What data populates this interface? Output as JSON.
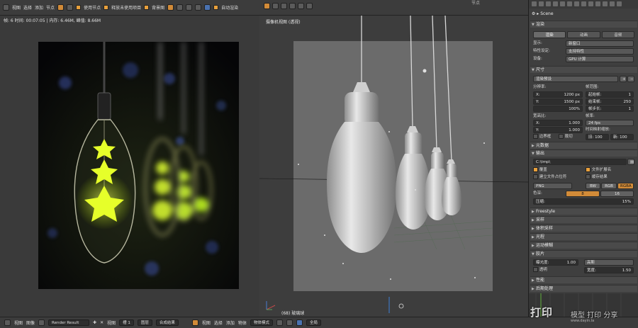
{
  "top_menu": {
    "view": "视图",
    "select": "选择",
    "add": "添加",
    "node": "节点",
    "use_nodes": "使用节点",
    "free_unused": "释放未使用项目",
    "backdrop": "背景图",
    "auto_render": "自动渲染",
    "node_panel_label": "节点"
  },
  "image_editor": {
    "stats": "帧: 6 时间: 00:07:05 | 内存: 6.46M, 峰值: 8.66M"
  },
  "viewport": {
    "title": "摄像机视图 (透视)",
    "object_label": "(68) 玻璃球",
    "mode": "物体模式",
    "menu": [
      "视图",
      "选择",
      "添加",
      "物体"
    ],
    "global": "全局"
  },
  "properties": {
    "scene": "Scene",
    "render_panel": "渲染",
    "render_tabs": [
      "渲染",
      "动画",
      "音频"
    ],
    "display_label": "显示:",
    "display_value": "新窗口",
    "feature_set_label": "特性设定:",
    "feature_set_value": "支持特性",
    "device_label": "设备:",
    "device_value": "GPU 计算",
    "dimensions_panel": "尺寸",
    "preset_value": "渲染预设",
    "resolution_label": "分辨率:",
    "res_x": "X:",
    "res_x_value": "1200 px",
    "res_y": "Y:",
    "res_y_value": "1500 px",
    "res_percent": "100%",
    "frame_range_label": "帧范围:",
    "start_label": "起始帧:",
    "start_value": "1",
    "end_label": "结束帧:",
    "end_value": "250",
    "step_label": "帧步长:",
    "step_value": "1",
    "aspect_label": "宽高比:",
    "aspect_x": "X:",
    "aspect_x_value": "1.000",
    "aspect_y": "Y:",
    "aspect_y_value": "1.000",
    "border_label": "边界框",
    "crop_label": "裁切",
    "frame_rate_label": "帧率:",
    "frame_rate_value": "24 fps",
    "time_remap_label": "时间映射缩放:",
    "remap_old": "旧: 100",
    "remap_new": "新: 100",
    "metadata_panel": "元数据",
    "output_panel": "输出",
    "output_path": "C:\\tmp\\",
    "overwrite_label": "覆盖",
    "file_ext_label": "文件扩展名",
    "placeholders_label": "建立文件占位符",
    "cache_result_label": "缓存结果",
    "format_value": "PNG",
    "bw": "BW",
    "rgb": "RGB",
    "rgba": "RGBA",
    "color_depth_label": "色深:",
    "depth_8": "8",
    "depth_16": "16",
    "compression_label": "压缩:",
    "compression_value": "15%",
    "freestyle_panel": "Freestyle",
    "sampling_panel": "采样",
    "volume_panel": "体积采样",
    "light_paths_panel": "光程",
    "motion_blur_panel": "运动模糊",
    "film_panel": "胶片",
    "exposure_label": "曝光度:",
    "exposure_value": "1.00",
    "filter_label": "高斯",
    "transparent_label": "透明",
    "width_label": "宽度:",
    "width_value": "1.50",
    "performance_panel": "性能",
    "post_panel": "后期处理"
  },
  "bottom_bar": {
    "view": "视图",
    "image": "图像",
    "render_result": "Render Result",
    "view2": "视图",
    "slot": "槽 1",
    "render_layer": "图层",
    "composite": "合成结果",
    "view3": "视图",
    "select": "选择",
    "add": "添加",
    "object": "物体",
    "mode": "物体模式"
  },
  "watermark": {
    "brand": "打印",
    "sub": "模型 打印 分享",
    "url": "www.dayin.la"
  },
  "colors": {
    "accent": "#d28b38",
    "selected_blue": "#5680c2",
    "glow": "#e6ff2a"
  }
}
